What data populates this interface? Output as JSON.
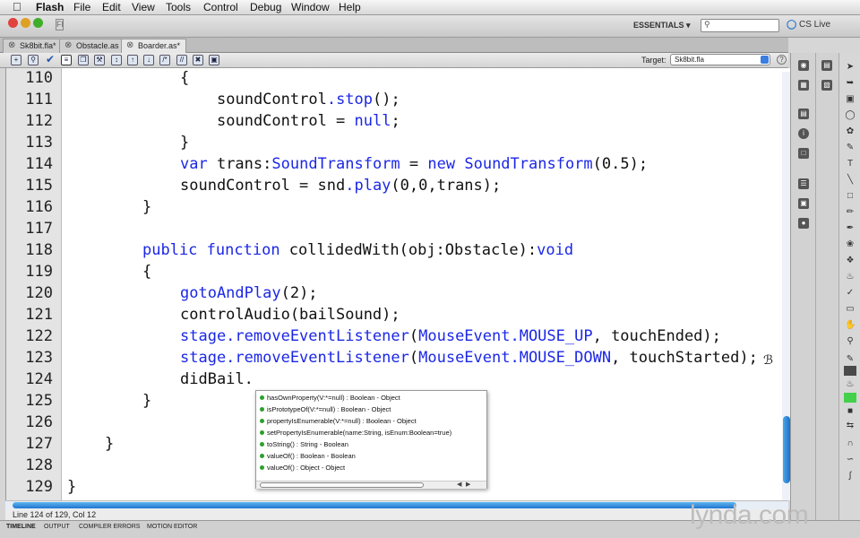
{
  "menu": {
    "app": "Flash",
    "items": [
      "File",
      "Edit",
      "View",
      "Tools",
      "Control",
      "Debug",
      "Window",
      "Help"
    ]
  },
  "toolbar": {
    "workspace": "ESSENTIALS ▾",
    "cs_live": "CS Live"
  },
  "tabs": [
    {
      "label": "Sk8bit.fla*"
    },
    {
      "label": "Obstacle.as"
    },
    {
      "label": "Boarder.as*"
    }
  ],
  "editor_toolbar": {
    "target_label": "Target:",
    "target_value": "Sk8bit.fla"
  },
  "code": {
    "line_numbers": [
      "110",
      "111",
      "112",
      "113",
      "114",
      "115",
      "116",
      "117",
      "118",
      "119",
      "120",
      "121",
      "122",
      "123",
      "124",
      "125",
      "126",
      "127",
      "128",
      "129"
    ],
    "l110": "{",
    "l111a": "soundControl",
    "l111b": ".stop",
    "l111c": "();",
    "l112a": "soundControl = ",
    "l112b": "null",
    "l112c": ";",
    "l113": "}",
    "l114a": "var",
    "l114b": " trans:",
    "l114c": "SoundTransform",
    "l114d": " = ",
    "l114e": "new",
    "l114f": " ",
    "l114g": "SoundTransform",
    "l114h": "(0.5);",
    "l115a": "soundControl = snd",
    "l115b": ".play",
    "l115c": "(0,0,trans);",
    "l116": "}",
    "l118a": "public",
    "l118b": " ",
    "l118c": "function",
    "l118d": " collidedWith(obj:Obstacle):",
    "l118e": "void",
    "l119": "{",
    "l120a": "gotoAndPlay",
    "l120b": "(2);",
    "l121": "controlAudio(bailSound);",
    "l122a": "stage.removeEventListener",
    "l122b": "(",
    "l122c": "MouseEvent.MOUSE_UP",
    "l122d": ", touchEnded);",
    "l123a": "stage.removeEventListener",
    "l123b": "(",
    "l123c": "MouseEvent.MOUSE_DOWN",
    "l123d": ", touchStarted);",
    "l124": "didBail.",
    "l125": "}",
    "l127": "}",
    "l129": "}"
  },
  "autocomplete": [
    "hasOwnProperty(V:*=null) : Boolean - Object",
    "isPrototypeOf(V:*=null) : Boolean - Object",
    "propertyIsEnumerable(V:*=null) : Boolean - Object",
    "setPropertyIsEnumerable(name:String, isEnum:Boolean=true)",
    "toString() : String - Boolean",
    "valueOf() : Boolean - Boolean",
    "valueOf() : Object - Object"
  ],
  "status": {
    "position": "Line 124 of 129, Col 12"
  },
  "bottom_tabs": [
    "TIMELINE",
    "OUTPUT",
    "COMPILER ERRORS",
    "MOTION EDITOR"
  ],
  "watermark": "lynda.com",
  "colors": {
    "keyword": "#1b27e6",
    "accent": "#1e6fc9",
    "swatch_green": "#44d04a"
  }
}
